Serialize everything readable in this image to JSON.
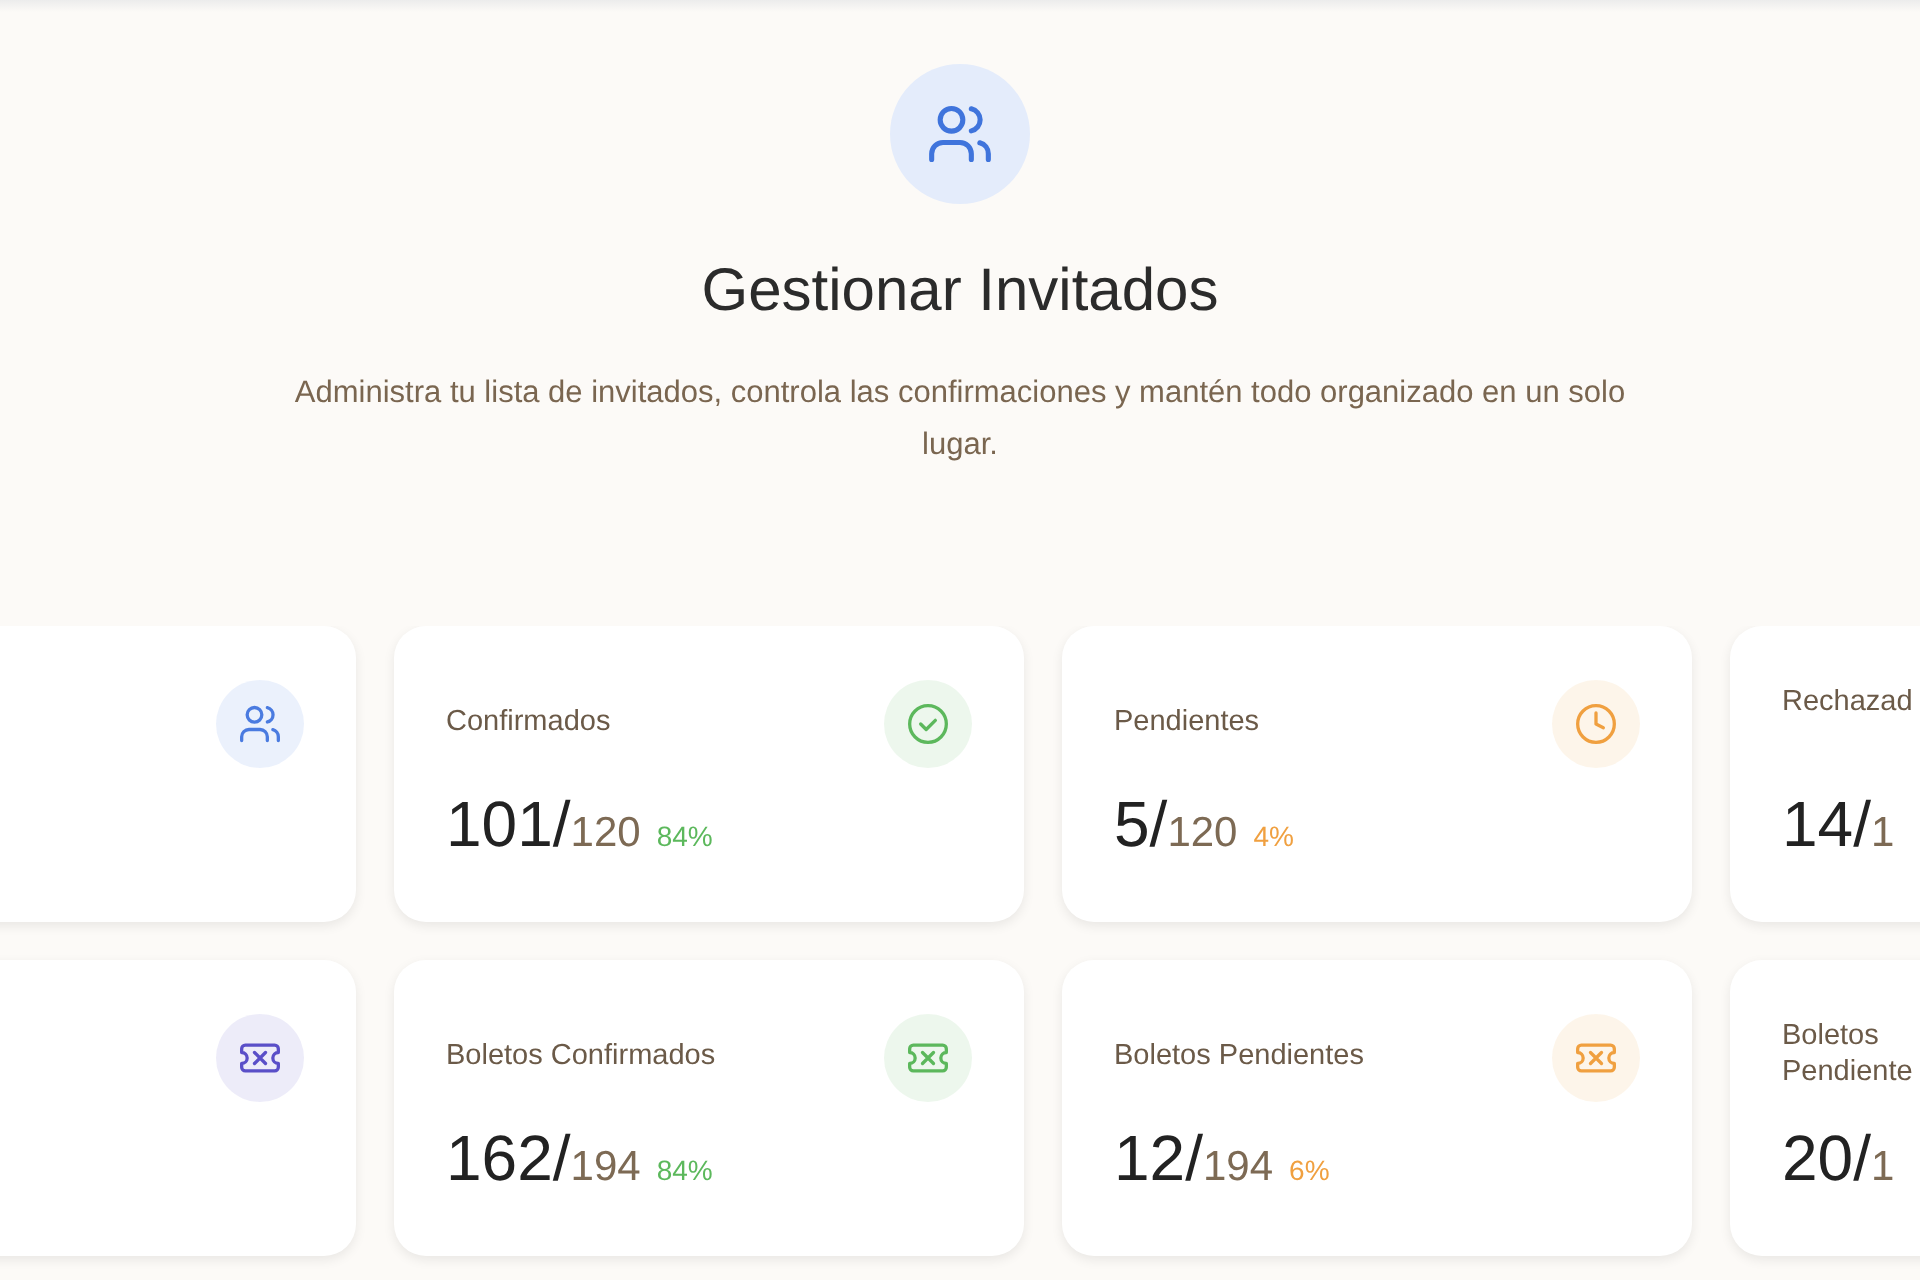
{
  "header": {
    "title": "Gestionar Invitados",
    "description": "Administra tu lista de invitados, controla las confirmaciones y mantén todo organizado en un solo lugar."
  },
  "stat_rows": [
    [
      {
        "kind": "users",
        "color": "#4a7be0"
      },
      {
        "label": "Confirmados",
        "count": "101/",
        "total": "120",
        "percent": "84%",
        "kind": "check",
        "color": "#5cb85c"
      },
      {
        "label": "Pendientes",
        "count": "5/",
        "total": "120",
        "percent": "4%",
        "kind": "clock",
        "color": "#f0a040"
      },
      {
        "label": "Rechazad",
        "count": "14/",
        "total": "1"
      }
    ],
    [
      {
        "kind": "ticket",
        "color": "#5a4fc8"
      },
      {
        "label": "Boletos Confirmados",
        "count": "162/",
        "total": "194",
        "percent": "84%",
        "kind": "ticket",
        "color": "#5cb85c"
      },
      {
        "label": "Boletos Pendientes",
        "count": "12/",
        "total": "194",
        "percent": "6%",
        "kind": "ticket",
        "color": "#f0a040"
      },
      {
        "label": "Boletos Pendiente",
        "count": "20/",
        "total": "1"
      }
    ]
  ]
}
